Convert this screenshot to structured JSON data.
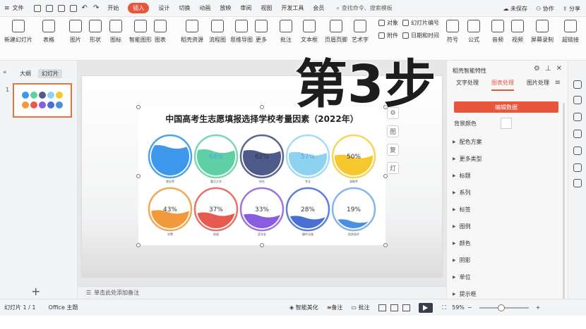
{
  "titlebar": {
    "file_menu": "文件",
    "menus": [
      "开始",
      "插入",
      "设计",
      "切换",
      "动画",
      "放映",
      "审阅",
      "视图",
      "开发工具",
      "会员"
    ],
    "active_menu": "插入",
    "search_placeholder": "查找命令、搜索模板",
    "unsaved": "未保存",
    "collab": "协作",
    "share": "分享"
  },
  "ribbon": {
    "buttons": [
      "新建幻灯片",
      "表格",
      "图片",
      "形状",
      "图标",
      "智能图形",
      "图表",
      "稻壳资源",
      "流程图",
      "思维导图",
      "更多",
      "批注",
      "文本框",
      "页眉页脚",
      "艺术字",
      "符号",
      "公式",
      "音频",
      "视频",
      "屏幕录制",
      "超链接"
    ],
    "small_items": [
      "对象",
      "幻灯片编号",
      "附件",
      "日期和时间"
    ]
  },
  "left_panel": {
    "tabs": [
      "大纲",
      "幻灯片"
    ],
    "active_tab": "幻灯片",
    "slide_number": "1",
    "add_label": "+"
  },
  "overlay_text": "第3步",
  "chart_data": {
    "type": "liquid-fill",
    "title": "中国高考生志愿填报选择学校考量因素（2022年）",
    "categories": [
      "就业率",
      "重点大学",
      "排名",
      "专业",
      "录取率",
      "学费",
      "地理",
      "奖学金",
      "硬件设施",
      "宿舍条件"
    ],
    "values": [
      75,
      64,
      62,
      57,
      50,
      43,
      37,
      33,
      28,
      19
    ],
    "value_labels": [
      "",
      "64%",
      "62%",
      "57%",
      "50%",
      "43%",
      "37%",
      "33%",
      "28%",
      "19%"
    ],
    "colors": [
      "#3d97ea",
      "#5fd0a6",
      "#4e5b8a",
      "#8fd2f0",
      "#f5c92e",
      "#f29a3b",
      "#e85a4f",
      "#8a5de0",
      "#4a6fd3",
      "#4a8fe0"
    ],
    "ring_colors": [
      "#4aa3ef",
      "#7ad7b2",
      "#5a6690",
      "#a5dcf3",
      "#f7d45a",
      "#f3a758",
      "#e97168",
      "#9b76e3",
      "#5e7fd8",
      "#86b4ec"
    ]
  },
  "side_tools": [
    "⚙",
    "图",
    "复",
    "灯"
  ],
  "notes_placeholder": "单击此处添加备注",
  "right_panel": {
    "header": "稻壳智能特性",
    "tabs": [
      "文字处理",
      "图表处理",
      "图片处理"
    ],
    "active_tab": "图表处理",
    "edit_button": "编辑数据",
    "bg_label": "背景颜色",
    "sections": [
      "配色方案",
      "更多类型",
      "标题",
      "系列",
      "标签",
      "图例",
      "颜色",
      "阴影",
      "单位",
      "提示框"
    ]
  },
  "statusbar": {
    "slide_info": "幻灯片 1 / 1",
    "theme": "Office 主题",
    "beautify": "智能美化",
    "notes": "备注",
    "comments": "批注",
    "zoom": "59%"
  }
}
